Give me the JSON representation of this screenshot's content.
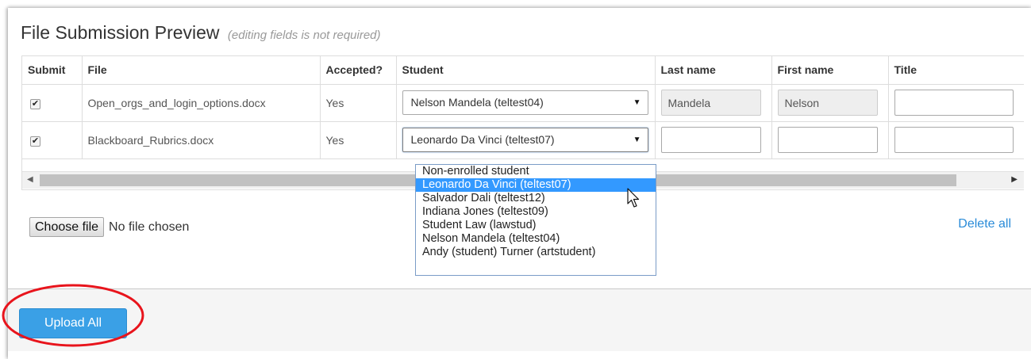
{
  "panel": {
    "title": "File Submission Preview",
    "subtitle": "(editing fields is not required)"
  },
  "table": {
    "columns": [
      "Submit",
      "File",
      "Accepted?",
      "Student",
      "Last name",
      "First name",
      "Title"
    ],
    "rows": [
      {
        "checked": "✔",
        "file": "Open_orgs_and_login_options.docx",
        "accepted": "Yes",
        "student": "Nelson Mandela (teltest04)",
        "last_name": "Mandela",
        "first_name": "Nelson",
        "title": ""
      },
      {
        "checked": "✔",
        "file": "Blackboard_Rubrics.docx",
        "accepted": "Yes",
        "student": "Leonardo Da Vinci (teltest07)",
        "last_name": "",
        "first_name": "",
        "title": ""
      }
    ]
  },
  "dropdown": {
    "options": [
      "Non-enrolled student",
      "Leonardo Da Vinci (teltest07)",
      "Salvador Dali (teltest12)",
      "Indiana Jones (teltest09)",
      "Student Law (lawstud)",
      "Nelson Mandela (teltest04)",
      "Andy (student) Turner (artstudent)"
    ],
    "highlighted": "Leonardo Da Vinci (teltest07)"
  },
  "file_input": {
    "button_label": "Choose file",
    "status": "No file chosen"
  },
  "delete_all_label": "Delete all",
  "upload_all_label": "Upload All",
  "icons": {
    "select_arrow": "caret-down-icon",
    "checkbox": "checkmark-icon",
    "scroll_left": "scroll-left-arrow-icon",
    "scroll_right": "scroll-right-arrow-icon",
    "pointer": "mouse-pointer-icon"
  },
  "colors": {
    "accent": "#3aa0e6",
    "link": "#2a8bd8",
    "accepted": "#3c8d2f",
    "highlight_ring": "#e8141c",
    "dropdown_selected": "#3399ff"
  }
}
